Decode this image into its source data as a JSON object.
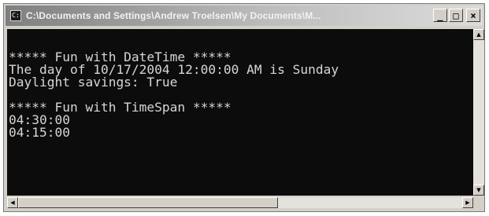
{
  "window": {
    "title": "C:\\Documents and Settings\\Andrew Troelsen\\My Documents\\M...",
    "minimize_glyph": "_",
    "maximize_glyph": "□",
    "close_glyph": "×"
  },
  "console": {
    "lines": [
      "***** Fun with DateTime *****",
      "The day of 10/17/2004 12:00:00 AM is Sunday",
      "Daylight savings: True",
      "",
      "***** Fun with TimeSpan *****",
      "04:30:00",
      "04:15:00"
    ]
  },
  "scrollbars": {
    "up_glyph": "▲",
    "down_glyph": "▼",
    "left_glyph": "◀",
    "right_glyph": "▶"
  }
}
